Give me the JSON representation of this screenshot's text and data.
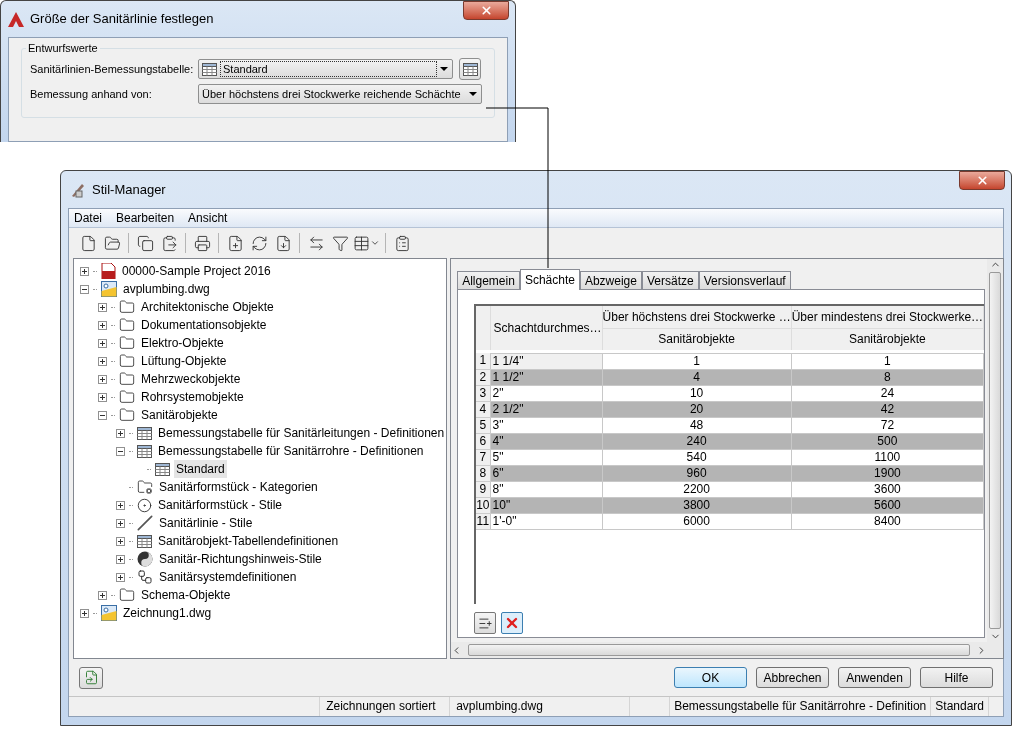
{
  "size_dialog": {
    "title": "Größe der Sanitärlinie festlegen",
    "group": "Entwurfswerte",
    "fields": [
      {
        "label": "Sanitärlinien-Bemessungstabelle:",
        "value": "Standard",
        "kind": "table"
      },
      {
        "label": "Bemessung anhand von:",
        "value": "Über höchstens drei Stockwerke reichende Schächte",
        "kind": "plain"
      }
    ]
  },
  "style_manager": {
    "title": "Stil-Manager",
    "menu": [
      "Datei",
      "Bearbeiten",
      "Ansicht"
    ],
    "tree": [
      {
        "label": "00000-Sample Project 2016",
        "kind": "project",
        "expanded": false,
        "selected": false
      },
      {
        "label": "avplumbing.dwg",
        "kind": "drawing",
        "expanded": true,
        "selected": false,
        "children": [
          {
            "label": "Architektonische Objekte",
            "kind": "folder",
            "expanded": false,
            "selected": false
          },
          {
            "label": "Dokumentationsobjekte",
            "kind": "folder",
            "expanded": false,
            "selected": false
          },
          {
            "label": "Elektro-Objekte",
            "kind": "folder",
            "expanded": false,
            "selected": false
          },
          {
            "label": "Lüftung-Objekte",
            "kind": "folder",
            "expanded": false,
            "selected": false
          },
          {
            "label": "Mehrzweckobjekte",
            "kind": "folder",
            "expanded": false,
            "selected": false
          },
          {
            "label": "Rohrsystemobjekte",
            "kind": "folder",
            "expanded": false,
            "selected": false
          },
          {
            "label": "Sanitärobjekte",
            "kind": "folder",
            "expanded": true,
            "selected": false,
            "children": [
              {
                "label": "Bemessungstabelle für Sanitärleitungen - Definitionen",
                "kind": "table",
                "expanded": false,
                "selected": false
              },
              {
                "label": "Bemessungstabelle für Sanitärrohre - Definitionen",
                "kind": "table",
                "expanded": true,
                "selected": false,
                "children": [
                  {
                    "label": "Standard",
                    "kind": "table",
                    "selected": true
                  }
                ]
              },
              {
                "label": "Sanitärformstück - Kategorien",
                "kind": "category",
                "selected": false
              },
              {
                "label": "Sanitärformstück - Stile",
                "kind": "fitting",
                "expanded": false,
                "selected": false
              },
              {
                "label": "Sanitärlinie - Stile",
                "kind": "line",
                "expanded": false,
                "selected": false
              },
              {
                "label": "Sanitärobjekt-Tabellendefinitionen",
                "kind": "table",
                "expanded": false,
                "selected": false
              },
              {
                "label": "Sanitär-Richtungshinweis-Stile",
                "kind": "flow",
                "expanded": false,
                "selected": false
              },
              {
                "label": "Sanitärsystemdefinitionen",
                "kind": "system",
                "expanded": false,
                "selected": false
              }
            ]
          },
          {
            "label": "Schema-Objekte",
            "kind": "folder",
            "expanded": false,
            "selected": false
          }
        ]
      },
      {
        "label": "Zeichnung1.dwg",
        "kind": "drawing",
        "expanded": false,
        "selected": false
      }
    ],
    "tabs": [
      {
        "label": "Allgemein",
        "selected": false
      },
      {
        "label": "Schächte",
        "selected": true
      },
      {
        "label": "Abzweige",
        "selected": false
      },
      {
        "label": "Versätze",
        "selected": false
      },
      {
        "label": "Versionsverlauf",
        "selected": false
      }
    ],
    "table": {
      "first_column": "Schachtdurchmes…",
      "groups": [
        {
          "title": "Über höchstens drei Stockwerke …",
          "sub": "Sanitärobjekte"
        },
        {
          "title": "Über mindestens drei Stockwerke…",
          "sub": "Sanitärobjekte"
        }
      ],
      "rows": [
        {
          "num": "1",
          "diameter": "1 1/4\"",
          "values": [
            "1",
            "1"
          ]
        },
        {
          "num": "2",
          "diameter": "1 1/2\"",
          "values": [
            "4",
            "8"
          ]
        },
        {
          "num": "3",
          "diameter": "2\"",
          "values": [
            "10",
            "24"
          ]
        },
        {
          "num": "4",
          "diameter": "2 1/2\"",
          "values": [
            "20",
            "42"
          ]
        },
        {
          "num": "5",
          "diameter": "3\"",
          "values": [
            "48",
            "72"
          ]
        },
        {
          "num": "6",
          "diameter": "4\"",
          "values": [
            "240",
            "500"
          ]
        },
        {
          "num": "7",
          "diameter": "5\"",
          "values": [
            "540",
            "1100"
          ]
        },
        {
          "num": "8",
          "diameter": "6\"",
          "values": [
            "960",
            "1900"
          ]
        },
        {
          "num": "9",
          "diameter": "8\"",
          "values": [
            "2200",
            "3600"
          ]
        },
        {
          "num": "10",
          "diameter": "10\"",
          "values": [
            "3800",
            "5600"
          ]
        },
        {
          "num": "11",
          "diameter": "1'-0\"",
          "values": [
            "6000",
            "8400"
          ]
        }
      ]
    },
    "buttons": [
      {
        "label": "OK",
        "default": true
      },
      {
        "label": "Abbrechen",
        "default": false
      },
      {
        "label": "Anwenden",
        "default": false
      },
      {
        "label": "Hilfe",
        "default": false
      }
    ],
    "status_bar": {
      "left": [
        "Zeichnungen sortiert",
        "avplumbing.dwg"
      ],
      "right": [
        "Bemessungstabelle für Sanitärrohre - Definition",
        "Standard"
      ]
    }
  }
}
